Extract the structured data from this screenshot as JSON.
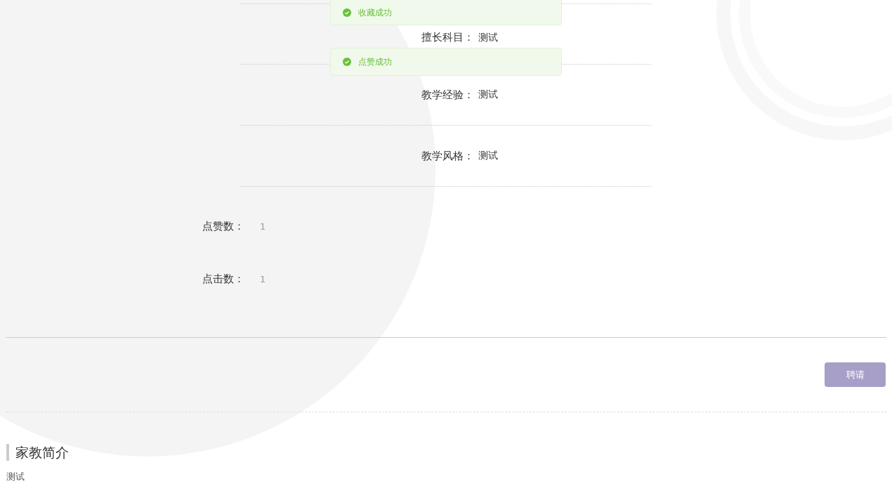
{
  "toasts": [
    {
      "kind": "success",
      "text": "收藏成功"
    },
    {
      "kind": "success",
      "text": "点赞成功"
    }
  ],
  "detail_rows": [
    {
      "label": "擅长科目：",
      "value": "测试"
    },
    {
      "label": "教学经验：",
      "value": "测试"
    },
    {
      "label": "教学风格：",
      "value": "测试"
    }
  ],
  "stats": [
    {
      "label": "点赞数：",
      "value": "1"
    },
    {
      "label": "点击数：",
      "value": "1"
    }
  ],
  "hire_button": "聘请",
  "section": {
    "title": "家教简介",
    "body": "测试"
  }
}
